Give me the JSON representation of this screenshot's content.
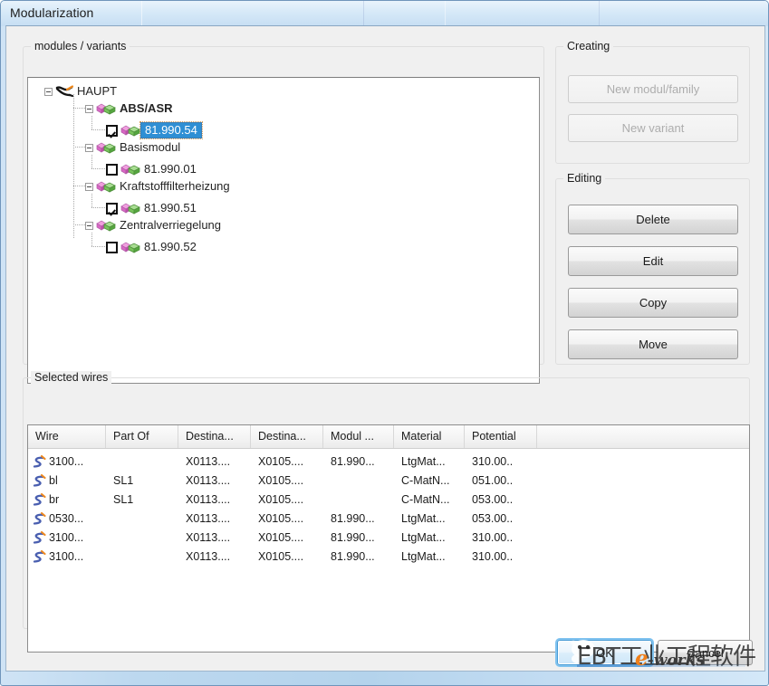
{
  "window": {
    "title": "Modularization"
  },
  "tree_group": {
    "caption": "modules / variants"
  },
  "tree": {
    "root": {
      "label": "HAUPT",
      "icon": "harness-icon",
      "expanded": true
    },
    "modules": [
      {
        "label": "ABS/ASR",
        "icon": "module-icon",
        "bold": true,
        "expanded": true,
        "variants": [
          {
            "label": "81.990.54",
            "icon": "variant-icon",
            "checked": true,
            "selected": true
          }
        ]
      },
      {
        "label": "Basismodul",
        "icon": "module-icon",
        "bold": false,
        "expanded": true,
        "variants": [
          {
            "label": "81.990.01",
            "icon": "variant-icon",
            "checked": false,
            "selected": false
          }
        ]
      },
      {
        "label": "Kraftstofffilterheizung",
        "icon": "module-icon",
        "bold": false,
        "expanded": true,
        "variants": [
          {
            "label": "81.990.51",
            "icon": "variant-icon",
            "checked": true,
            "selected": false
          }
        ]
      },
      {
        "label": "Zentralverriegelung",
        "icon": "module-icon",
        "bold": false,
        "expanded": true,
        "variants": [
          {
            "label": "81.990.52",
            "icon": "variant-icon",
            "checked": false,
            "selected": false
          }
        ]
      }
    ]
  },
  "creating": {
    "caption": "Creating",
    "buttons": [
      {
        "label": "New modul/family",
        "enabled": false
      },
      {
        "label": "New variant",
        "enabled": false
      }
    ]
  },
  "editing": {
    "caption": "Editing",
    "buttons": [
      {
        "label": "Delete",
        "enabled": true
      },
      {
        "label": "Edit",
        "enabled": true
      },
      {
        "label": "Copy",
        "enabled": true
      },
      {
        "label": "Move",
        "enabled": true
      }
    ]
  },
  "selected_wires": {
    "caption": "Selected wires",
    "columns": [
      "Wire",
      "Part Of",
      "Destina...",
      "Destina...",
      "Modul ...",
      "Material",
      "Potential",
      ""
    ],
    "rows": [
      {
        "icon": "wire-icon",
        "wire": "3100...",
        "part_of": "",
        "destination_1": "X0113....",
        "destination_2": "X0105....",
        "modul": "81.990...",
        "material": "LtgMat...",
        "potential": "310.00.."
      },
      {
        "icon": "wire-icon",
        "wire": "bl",
        "part_of": "SL1",
        "destination_1": "X0113....",
        "destination_2": "X0105....",
        "modul": "",
        "material": "C-MatN...",
        "potential": "051.00.."
      },
      {
        "icon": "wire-icon",
        "wire": "br",
        "part_of": "SL1",
        "destination_1": "X0113....",
        "destination_2": "X0105....",
        "modul": "",
        "material": "C-MatN...",
        "potential": "053.00.."
      },
      {
        "icon": "wire-icon",
        "wire": "0530...",
        "part_of": "",
        "destination_1": "X0113....",
        "destination_2": "X0105....",
        "modul": "81.990...",
        "material": "LtgMat...",
        "potential": "053.00.."
      },
      {
        "icon": "wire-icon",
        "wire": "3100...",
        "part_of": "",
        "destination_1": "X0113....",
        "destination_2": "X0105....",
        "modul": "81.990...",
        "material": "LtgMat...",
        "potential": "310.00.."
      },
      {
        "icon": "wire-icon",
        "wire": "3100...",
        "part_of": "",
        "destination_1": "X0113....",
        "destination_2": "X0105....",
        "modul": "81.990...",
        "material": "LtgMat...",
        "potential": "310.00.."
      }
    ]
  },
  "footer": {
    "ok_label": "OK",
    "cancel_label": "Cancel",
    "ok_focused": true
  },
  "watermark": {
    "text": "EBT工业工程软件",
    "logo_mark": "e",
    "logo_text": "-works"
  },
  "colors": {
    "accent": "#2f8fd4",
    "titlebar": "#c6def3",
    "dialog_face": "#f0f0f0",
    "module_icon_pink": "#e27ad0",
    "module_icon_green": "#63b54a",
    "wire_icon_blue": "#4a5fb0",
    "wire_icon_orange": "#ef8a1f",
    "watermark_orange": "#ef7f1a"
  }
}
